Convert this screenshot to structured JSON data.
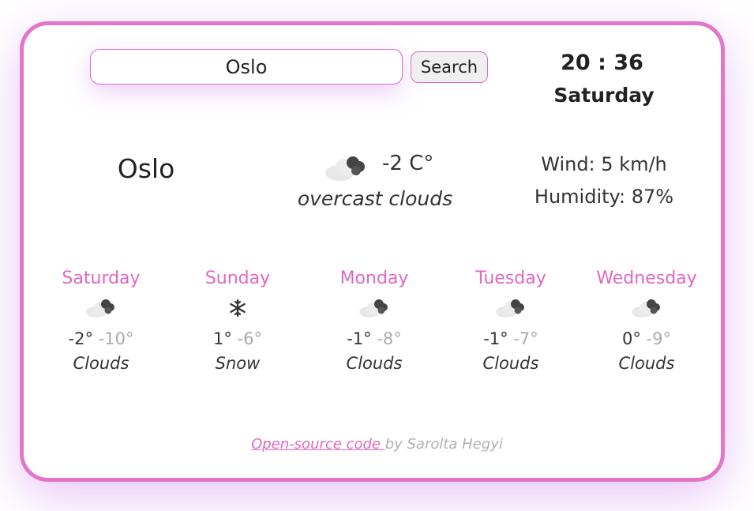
{
  "search": {
    "value": "Oslo",
    "placeholder": "",
    "button_label": "Search"
  },
  "clock": {
    "time": "20 : 36",
    "weekday": "Saturday"
  },
  "current": {
    "city": "Oslo",
    "icon": "cloud-icon",
    "temperature": "-2 C°",
    "description": "overcast clouds",
    "wind": "Wind: 5 km/h",
    "humidity": "Humidity: 87%"
  },
  "forecast": [
    {
      "day": "Saturday",
      "icon": "cloud-icon",
      "max": "-2°",
      "min": "-10°",
      "desc": "Clouds"
    },
    {
      "day": "Sunday",
      "icon": "snowflake-icon",
      "max": "1°",
      "min": "-6°",
      "desc": "Snow"
    },
    {
      "day": "Monday",
      "icon": "cloud-icon",
      "max": "-1°",
      "min": "-8°",
      "desc": "Clouds"
    },
    {
      "day": "Tuesday",
      "icon": "cloud-icon",
      "max": "-1°",
      "min": "-7°",
      "desc": "Clouds"
    },
    {
      "day": "Wednesday",
      "icon": "cloud-icon",
      "max": "0°",
      "min": "-9°",
      "desc": "Clouds"
    }
  ],
  "footer": {
    "link_text": "Open-source code ",
    "author": "by Sarolta Hegyi"
  },
  "colors": {
    "accent": "#e276c9",
    "day_label": "#e067c3",
    "muted": "#aaaaaa"
  }
}
